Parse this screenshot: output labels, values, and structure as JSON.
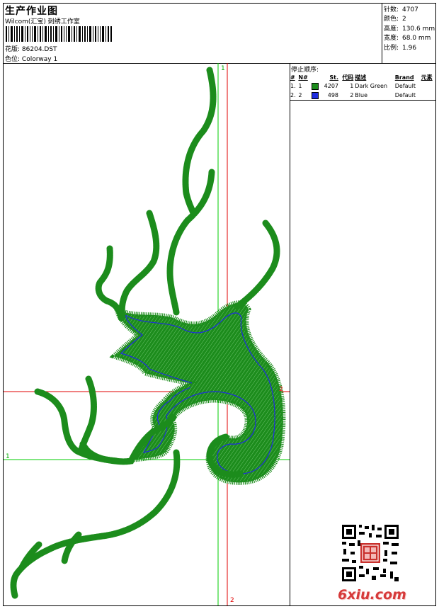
{
  "header": {
    "title": "生产作业图",
    "subtitle": "Wilcom(汇宝) 刺绣工作室",
    "file_label": "花版:",
    "file_value": "86204.DST",
    "colorway_label": "色位:",
    "colorway_value": "Colorway 1"
  },
  "stats": [
    {
      "label": "针数:",
      "value": "4707"
    },
    {
      "label": "颜色:",
      "value": "2"
    },
    {
      "label": "高度:",
      "value": "130.6 mm"
    },
    {
      "label": "宽度:",
      "value": "68.0 mm"
    },
    {
      "label": "比例:",
      "value": "1.96"
    }
  ],
  "stop_sequence": {
    "heading": "停止顺序:",
    "columns": [
      "#",
      "N#",
      "St.",
      "代码",
      "描述",
      "Brand",
      "元素"
    ],
    "rows": [
      {
        "index": "1.",
        "n": "1",
        "color": "#1c8c1c",
        "stitches": "4207",
        "code": "1",
        "description": "Dark Green",
        "brand": "Default"
      },
      {
        "index": "2.",
        "n": "2",
        "color": "#1f2de0",
        "stitches": "498",
        "code": "2",
        "description": "Blue",
        "brand": "Default"
      }
    ]
  },
  "markers": {
    "green": "1",
    "red": "2"
  },
  "watermark": {
    "site": "6xiu.com",
    "qr_icon": "qr-code-icon",
    "seal_icon": "seal-stamp-icon"
  },
  "colors": {
    "stitch_green": "#1c8c1c",
    "stitch_blue": "#1f2de0",
    "guide_green": "#00cc00",
    "guide_red": "#e00000"
  }
}
